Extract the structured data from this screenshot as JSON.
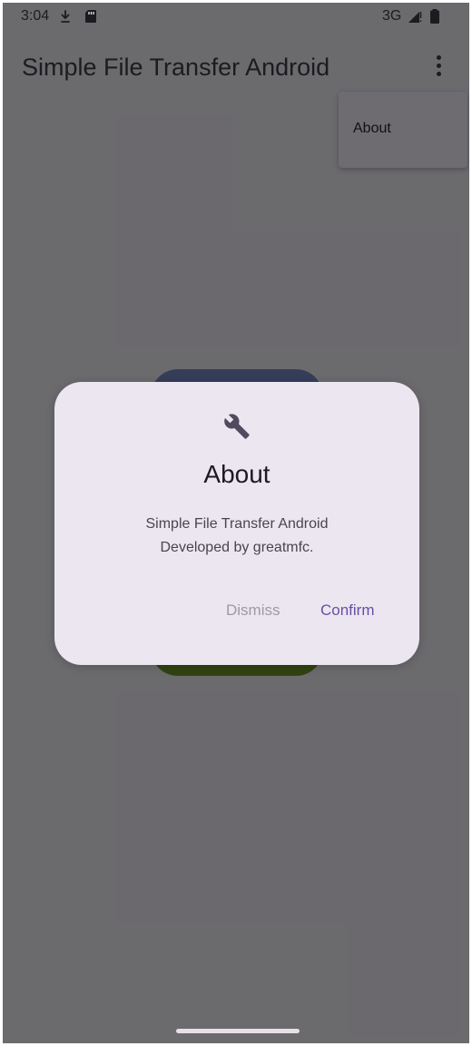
{
  "status_bar": {
    "time": "3:04",
    "network": "3G",
    "icons": [
      "download-notification-icon",
      "sd-card-icon",
      "signal-icon",
      "battery-icon"
    ]
  },
  "app_bar": {
    "title": "Simple File Transfer Android",
    "overflow_icon": "more-vert-icon"
  },
  "overflow_menu": {
    "items": [
      {
        "label": "About"
      }
    ]
  },
  "dialog": {
    "icon": "wrench-icon",
    "title": "About",
    "body_lines": [
      "Simple File Transfer Android",
      "Developed by greatmfc."
    ],
    "dismiss_label": "Dismiss",
    "confirm_label": "Confirm"
  },
  "colors": {
    "scrim": "#69676b",
    "dialog_surface": "#ece6f0",
    "primary": "#6750a4",
    "card_top": "#6a7dc4",
    "card_bottom": "#5d8a00"
  }
}
